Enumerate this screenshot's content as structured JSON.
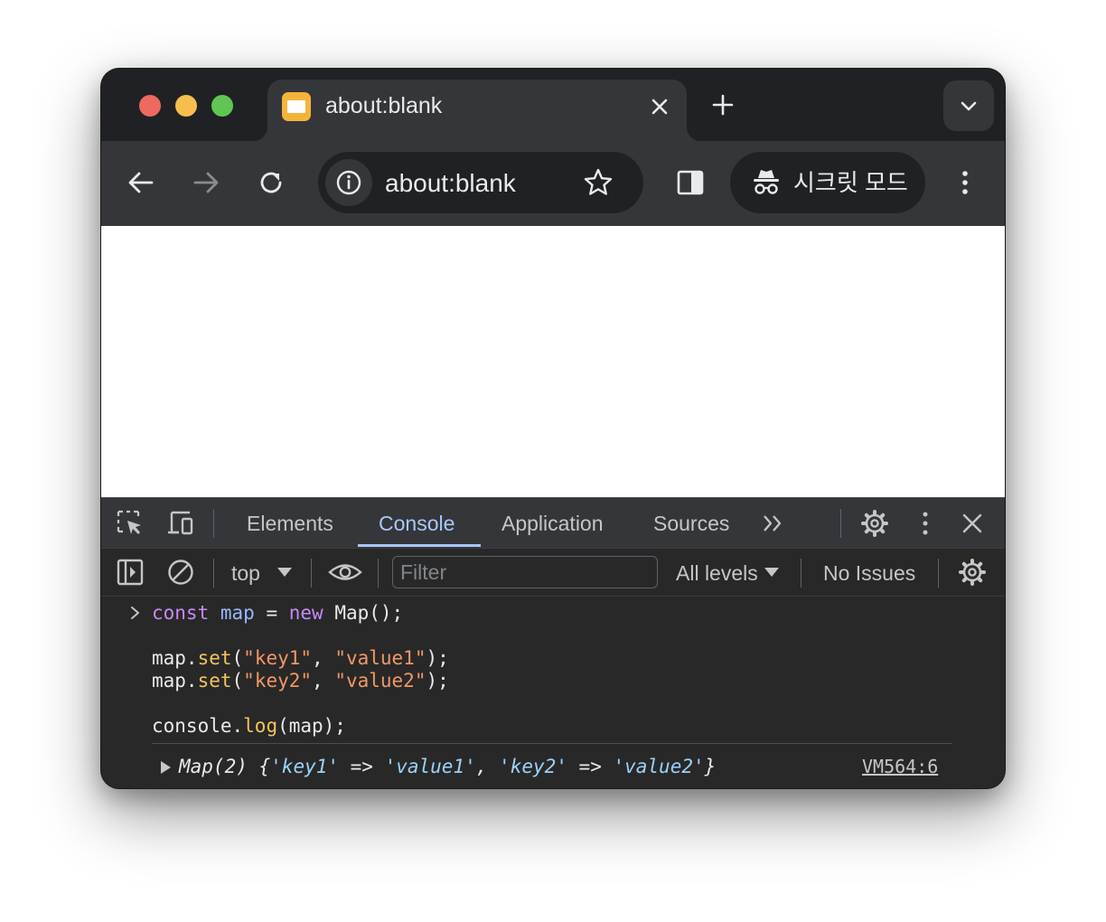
{
  "window": {
    "tab": {
      "title": "about:blank",
      "favicon": "blank-page-favicon"
    },
    "toolbar": {
      "url": "about:blank",
      "incognito_label": "시크릿 모드"
    }
  },
  "devtools": {
    "tabs": [
      {
        "label": "Elements"
      },
      {
        "label": "Console"
      },
      {
        "label": "Application"
      },
      {
        "label": "Sources"
      }
    ],
    "active_tab": "Console",
    "console_bar": {
      "context": "top",
      "filter_placeholder": "Filter",
      "levels": "All levels",
      "issues": "No Issues"
    },
    "console": {
      "input": {
        "line1": {
          "kw1": "const",
          "var": "map",
          "op": " = ",
          "kw2": "new",
          "rest": " Map();"
        },
        "line3": {
          "obj": "map.",
          "fn": "set",
          "open": "(",
          "k": "\"key1\"",
          "comma": ", ",
          "v": "\"value1\"",
          "close": ");"
        },
        "line4": {
          "obj": "map.",
          "fn": "set",
          "open": "(",
          "k": "\"key2\"",
          "comma": ", ",
          "v": "\"value2\"",
          "close": ");"
        },
        "line6": {
          "obj": "console.",
          "fn": "log",
          "rest": "(map);"
        }
      },
      "output": {
        "prefix": "Map(2) {",
        "key1": "'key1'",
        "arrow1": " => ",
        "val1": "'value1'",
        "sep": ", ",
        "key2": "'key2'",
        "arrow2": " => ",
        "val2": "'value2'",
        "suffix": "}",
        "source": "VM564:6"
      }
    }
  },
  "colors": {
    "tab_active": "#35363a",
    "frame": "#202124",
    "devtools_accent": "#a8c7fa",
    "keyword": "#c58af9",
    "string": "#f29766",
    "function": "#f2c55c"
  }
}
